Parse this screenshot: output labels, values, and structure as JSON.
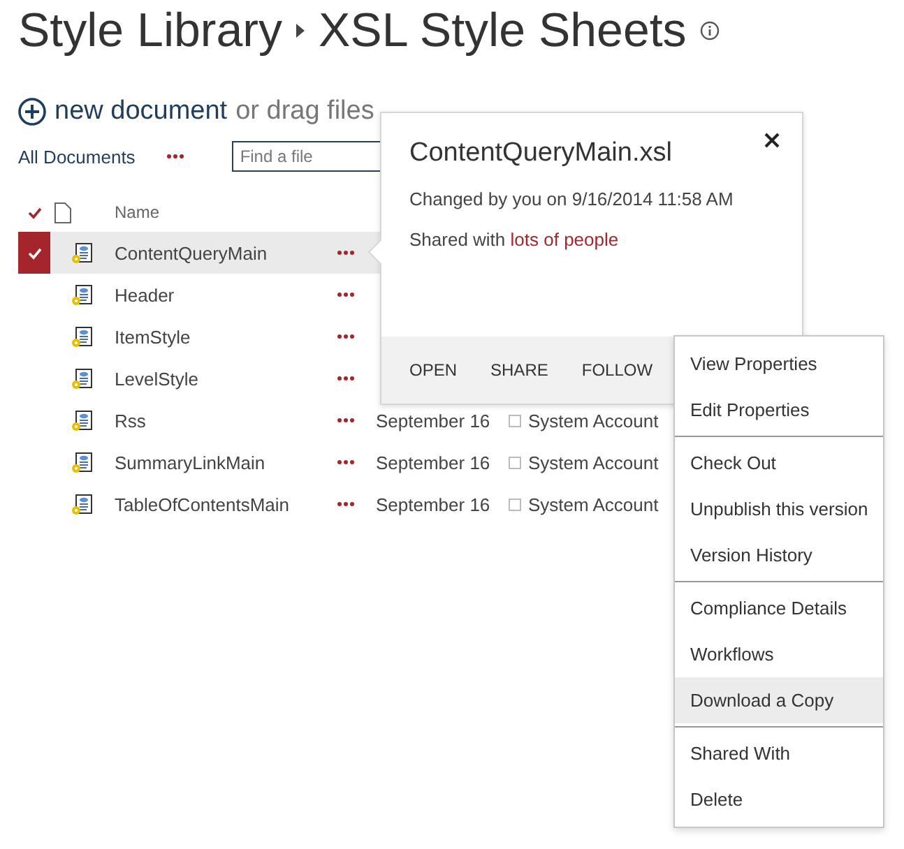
{
  "title": {
    "library": "Style Library",
    "folder": "XSL Style Sheets"
  },
  "new_document": {
    "label": "new document",
    "hint": "or drag files"
  },
  "view": {
    "label": "All Documents"
  },
  "search": {
    "placeholder": "Find a file"
  },
  "columns": {
    "name": "Name"
  },
  "rows": [
    {
      "name": "ContentQueryMain",
      "selected": true
    },
    {
      "name": "Header",
      "selected": false
    },
    {
      "name": "ItemStyle",
      "selected": false
    },
    {
      "name": "LevelStyle",
      "selected": false
    },
    {
      "name": "Rss",
      "selected": false,
      "date": "September 16",
      "account": "System Account"
    },
    {
      "name": "SummaryLinkMain",
      "selected": false,
      "date": "September 16",
      "account": "System Account"
    },
    {
      "name": "TableOfContentsMain",
      "selected": false,
      "date": "September 16",
      "account": "System Account"
    }
  ],
  "callout": {
    "title": "ContentQueryMain.xsl",
    "changed": "Changed by you on 9/16/2014 11:58 AM",
    "shared_prefix": "Shared with",
    "shared_link": "lots of people",
    "actions": [
      "OPEN",
      "SHARE",
      "FOLLOW"
    ]
  },
  "menu": [
    [
      {
        "label": "View Properties",
        "selected": false
      },
      {
        "label": "Edit Properties",
        "selected": false
      }
    ],
    [
      {
        "label": "Check Out",
        "selected": false
      },
      {
        "label": "Unpublish this version",
        "selected": false
      },
      {
        "label": "Version History",
        "selected": false
      }
    ],
    [
      {
        "label": "Compliance Details",
        "selected": false
      },
      {
        "label": "Workflows",
        "selected": false
      },
      {
        "label": "Download a Copy",
        "selected": true
      }
    ],
    [
      {
        "label": "Shared With",
        "selected": false
      },
      {
        "label": "Delete",
        "selected": false
      }
    ]
  ]
}
